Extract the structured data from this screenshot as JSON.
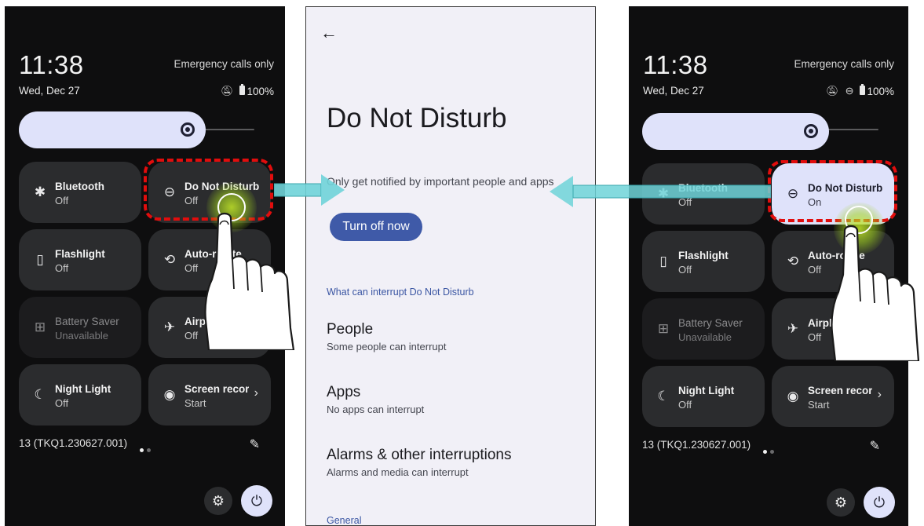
{
  "left_panel": {
    "time": "11:38",
    "emergency": "Emergency calls only",
    "date": "Wed, Dec 27",
    "battery": "100%",
    "tiles": [
      {
        "title": "Bluetooth",
        "sub": "Off"
      },
      {
        "title": "Do Not Disturb",
        "sub": "Off"
      },
      {
        "title": "Flashlight",
        "sub": "Off"
      },
      {
        "title": "Auto-rotate",
        "sub": "Off"
      },
      {
        "title": "Battery Saver",
        "sub": "Unavailable"
      },
      {
        "title": "Airplane mode",
        "sub": "Off"
      },
      {
        "title": "Night Light",
        "sub": "Off"
      },
      {
        "title": "Screen record",
        "sub": "Start"
      }
    ],
    "build": "13 (TKQ1.230627.001)"
  },
  "right_panel": {
    "time": "11:38",
    "emergency": "Emergency calls only",
    "date": "Wed, Dec 27",
    "battery": "100%",
    "tiles": [
      {
        "title": "Bluetooth",
        "sub": "Off"
      },
      {
        "title": "Do Not Disturb",
        "sub": "On"
      },
      {
        "title": "Flashlight",
        "sub": "Off"
      },
      {
        "title": "Auto-rotate",
        "sub": "Off"
      },
      {
        "title": "Battery Saver",
        "sub": "Unavailable"
      },
      {
        "title": "Airplane mode",
        "sub": "Off"
      },
      {
        "title": "Night Light",
        "sub": "Off"
      },
      {
        "title": "Screen record",
        "sub": "Start"
      }
    ],
    "build": "13 (TKQ1.230627.001)"
  },
  "dnd_page": {
    "title": "Do Not Disturb",
    "description": "Only get notified by important people and apps",
    "turn_off_label": "Turn off now",
    "section_label": "What can interrupt Do Not Disturb",
    "items": [
      {
        "title": "People",
        "sub": "Some people can interrupt"
      },
      {
        "title": "Apps",
        "sub": "No apps can interrupt"
      },
      {
        "title": "Alarms & other interruptions",
        "sub": "Alarms and media can interrupt"
      }
    ],
    "general_label": "General"
  },
  "colors": {
    "panel_bg": "#0e0e0f",
    "tile_bg": "#2b2c2e",
    "tile_on": "#dfe2fa",
    "accent_blue": "#3f5aa8",
    "highlight_red": "#e10d0d",
    "arrow_teal": "#6fd3d8",
    "tap_glow": "#c4e928"
  }
}
